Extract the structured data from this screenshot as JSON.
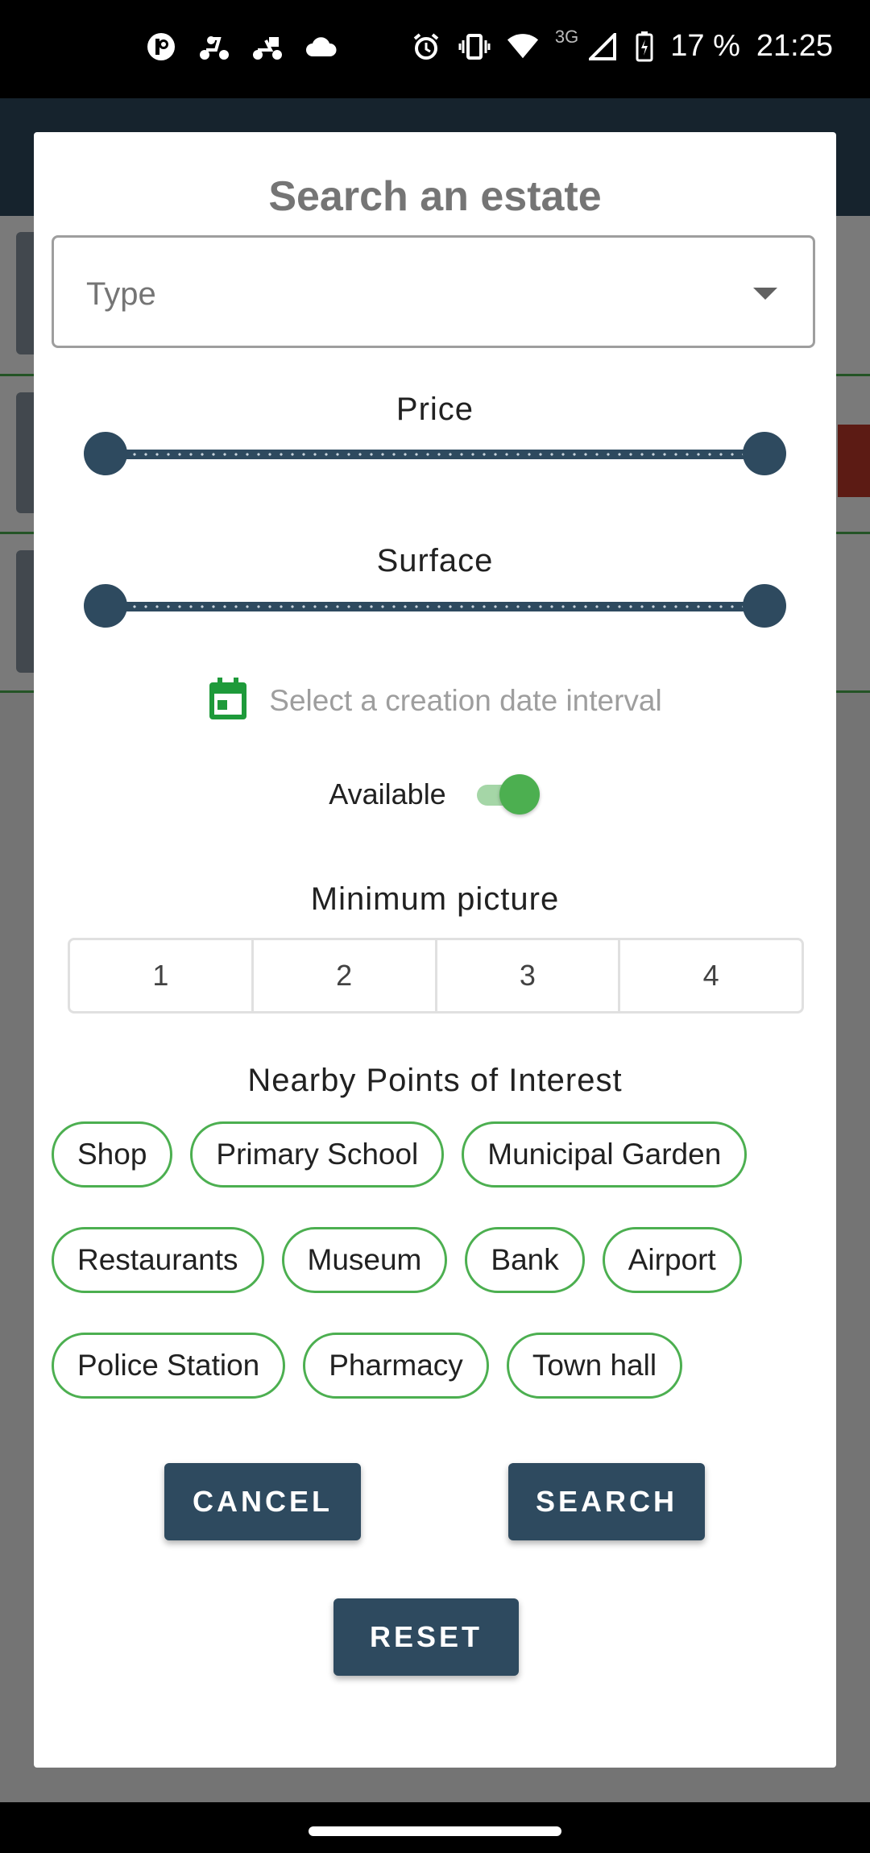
{
  "status_bar": {
    "left_icons": [
      "notification-p-icon",
      "scooter-icon",
      "delivery-icon",
      "cloud-icon"
    ],
    "right_icons": [
      "alarm-icon",
      "vibrate-icon",
      "wifi-icon",
      "signal-icon",
      "battery-charging-icon"
    ],
    "network": "3G",
    "battery": "17 %",
    "time": "21:25"
  },
  "dialog": {
    "title": "Search an estate",
    "type_placeholder": "Type",
    "price_label": "Price",
    "surface_label": "Surface",
    "date_interval_text": "Select a creation date interval",
    "available_label": "Available",
    "available_on": true,
    "min_picture_label": "Minimum picture",
    "min_picture_options": [
      "1",
      "2",
      "3",
      "4"
    ],
    "poi_label": "Nearby Points of Interest",
    "poi_chips": [
      [
        "Shop",
        "Primary School",
        "Municipal Garden"
      ],
      [
        "Restaurants",
        "Museum",
        "Bank",
        "Airport"
      ],
      [
        "Police Station",
        "Pharmacy",
        "Town hall"
      ]
    ],
    "cancel_label": "CANCEL",
    "search_label": "SEARCH",
    "reset_label": "RESET"
  },
  "colors": {
    "primary": "#2e4a5f",
    "accent_green": "#4caf50",
    "scrim": "rgba(0,0,0,0.52)"
  }
}
